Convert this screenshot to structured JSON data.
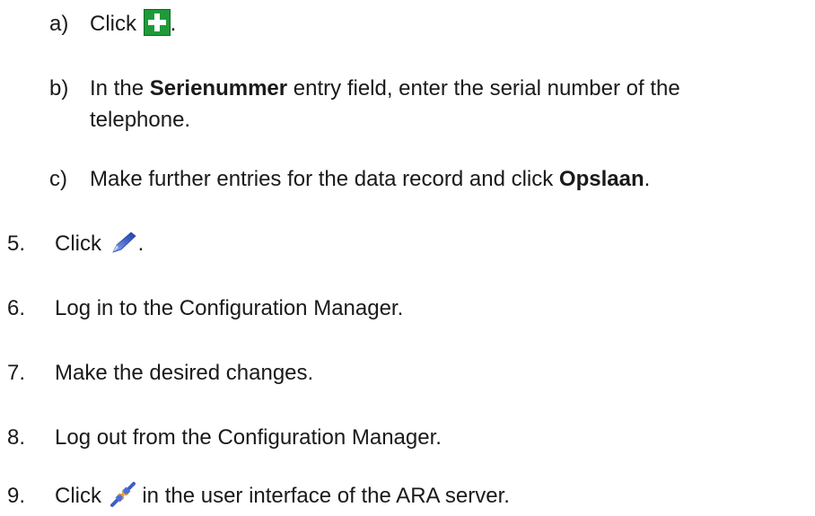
{
  "steps": [
    {
      "marker": "a)",
      "before": "Click ",
      "after": "."
    },
    {
      "marker": "b)",
      "before": "In the ",
      "bold": "Serienummer",
      "after": " entry field, enter the serial number of the",
      "continuation": "telephone."
    },
    {
      "marker": "c)",
      "before": "Make further entries for the data record and click ",
      "bold": "Opslaan",
      "after": "."
    },
    {
      "marker": "5.",
      "before": "Click ",
      "after": "."
    },
    {
      "marker": "6.",
      "text": "Log in to the Configuration Manager."
    },
    {
      "marker": "7.",
      "text": "Make the desired changes."
    },
    {
      "marker": "8.",
      "text": "Log out from the Configuration Manager."
    },
    {
      "marker": "9.",
      "before": "Click ",
      "after": " in the user interface of the ARA server."
    }
  ],
  "icons": {
    "add": "green-plus-icon",
    "edit": "blue-pen-icon",
    "connect": "disconnect-plug-icon"
  },
  "colors": {
    "plus_icon_bg": "#1e9a3a",
    "text": "#1a1a1a"
  }
}
